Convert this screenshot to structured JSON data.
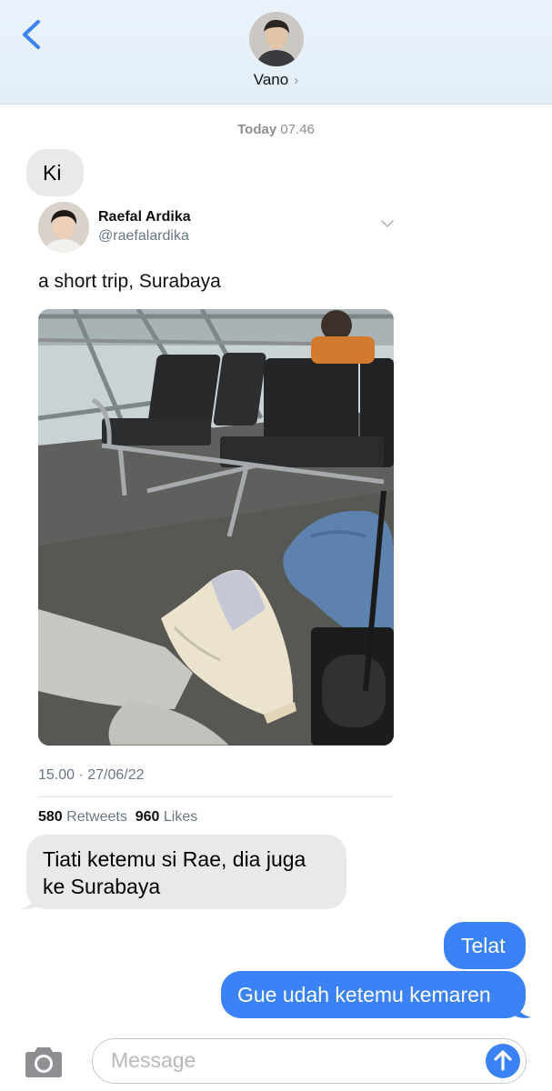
{
  "header": {
    "contact_name": "Vano",
    "name_chevron": "›"
  },
  "conversation": {
    "timestamp_day": "Today",
    "timestamp_time": "07.46",
    "messages": [
      {
        "direction": "received",
        "text": "Ki"
      },
      {
        "direction": "received",
        "text_line1": "Tiati ketemu si Rae, dia juga",
        "text_line2": "ke Surabaya"
      },
      {
        "direction": "sent",
        "text": "Telat"
      },
      {
        "direction": "sent",
        "text": "Gue udah ketemu kemaren"
      }
    ]
  },
  "tweet": {
    "author_name": "Raefal Ardika",
    "author_handle": "@raefalardika",
    "text": "a short trip, Surabaya",
    "posted_at": "15.00 · 27/06/22",
    "retweets_count": "580",
    "retweets_label": "Retweets",
    "likes_count": "960",
    "likes_label": "Likes"
  },
  "composer": {
    "placeholder": "Message",
    "value": ""
  },
  "colors": {
    "accent_blue": "#3a82f6",
    "received_bubble": "#e9e9eb",
    "header_background": "#e6f0fa"
  },
  "icons": [
    "back-chevron-icon",
    "chevron-right-icon",
    "caret-down-icon",
    "camera-icon",
    "send-arrow-icon"
  ]
}
